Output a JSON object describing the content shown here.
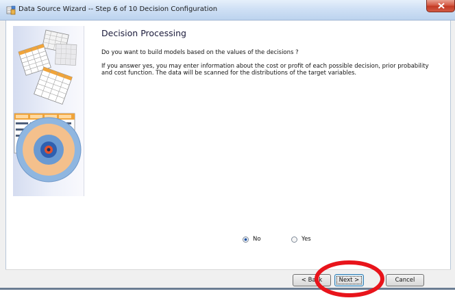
{
  "window": {
    "title": "Data Source Wizard  -- Step 6 of 10  Decision Configuration",
    "close_icon": "close-icon",
    "app_icon": "data-source-wizard-icon"
  },
  "content": {
    "heading": "Decision Processing",
    "question": "Do you want to build models based on the values of the decisions ?",
    "explanation": "If you answer yes, you may enter information about the cost or profit of each possible decision, prior probability and cost function. The data will be scanned for the distributions of the target variables."
  },
  "options": {
    "no_label": "No",
    "yes_label": "Yes",
    "selected": "No"
  },
  "buttons": {
    "back_label": "< Back",
    "next_label": "Next >",
    "cancel_label": "Cancel"
  },
  "annotation": {
    "color": "#e8141b",
    "target": "Next >"
  }
}
